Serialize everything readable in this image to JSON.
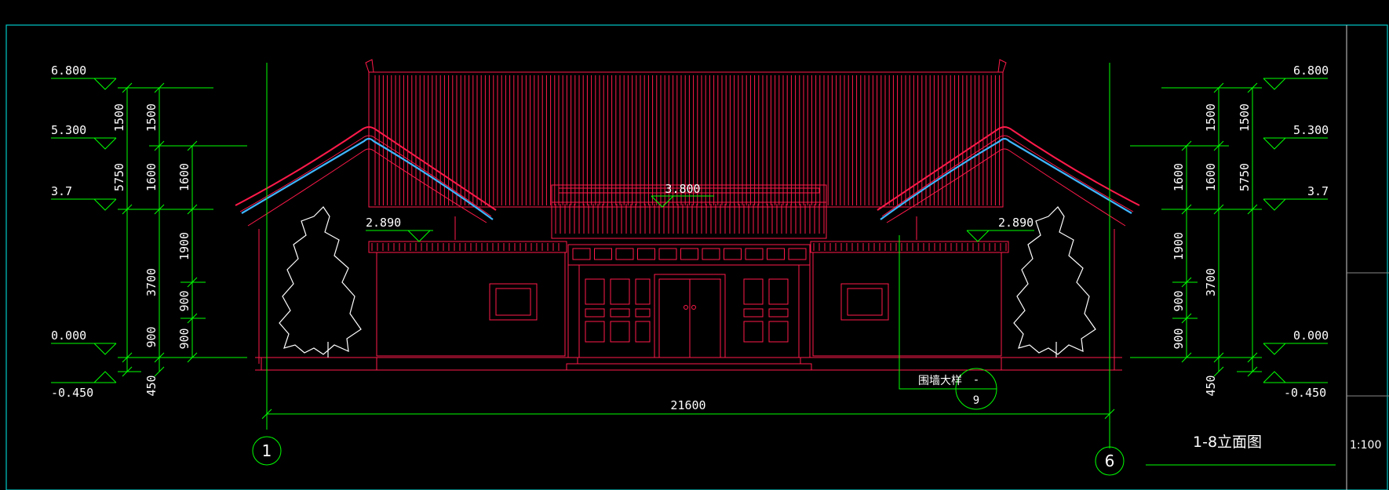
{
  "drawing": {
    "title": "1-8立面图",
    "scale": "1:100",
    "overall_dimension": "21600",
    "detail_callout": {
      "label": "围墙大样",
      "number": "-",
      "sheet": "9"
    },
    "grid_axes": [
      "1",
      "6"
    ]
  },
  "elevations": {
    "left": [
      {
        "id": "roof-ridge",
        "value": "6.800"
      },
      {
        "id": "roof-eave",
        "value": "5.300"
      },
      {
        "id": "wall-top",
        "value": "3.7"
      },
      {
        "id": "ground",
        "value": "0.000"
      },
      {
        "id": "base",
        "value": "-0.450"
      }
    ],
    "right": [
      {
        "id": "roof-ridge",
        "value": "6.800"
      },
      {
        "id": "roof-eave",
        "value": "5.300"
      },
      {
        "id": "wall-top",
        "value": "3.7"
      },
      {
        "id": "ground",
        "value": "0.000"
      },
      {
        "id": "base",
        "value": "-0.450"
      }
    ],
    "center_mark": "3.800",
    "side_marks": [
      "2.890",
      "2.890"
    ]
  },
  "dimension_chains": {
    "outer": [
      "1500",
      "5750",
      "3700",
      "450"
    ],
    "inner": [
      "1500",
      "1600",
      "1900",
      "900",
      "900"
    ]
  },
  "colors": {
    "background": "#000000",
    "dimension": "#00ff00",
    "building": "#ff1a4a",
    "wall_outline": "#ff2b2b",
    "ridge_tile": "#3fb6ff",
    "tree": "#ffffff",
    "frame": "#00c9c9"
  }
}
